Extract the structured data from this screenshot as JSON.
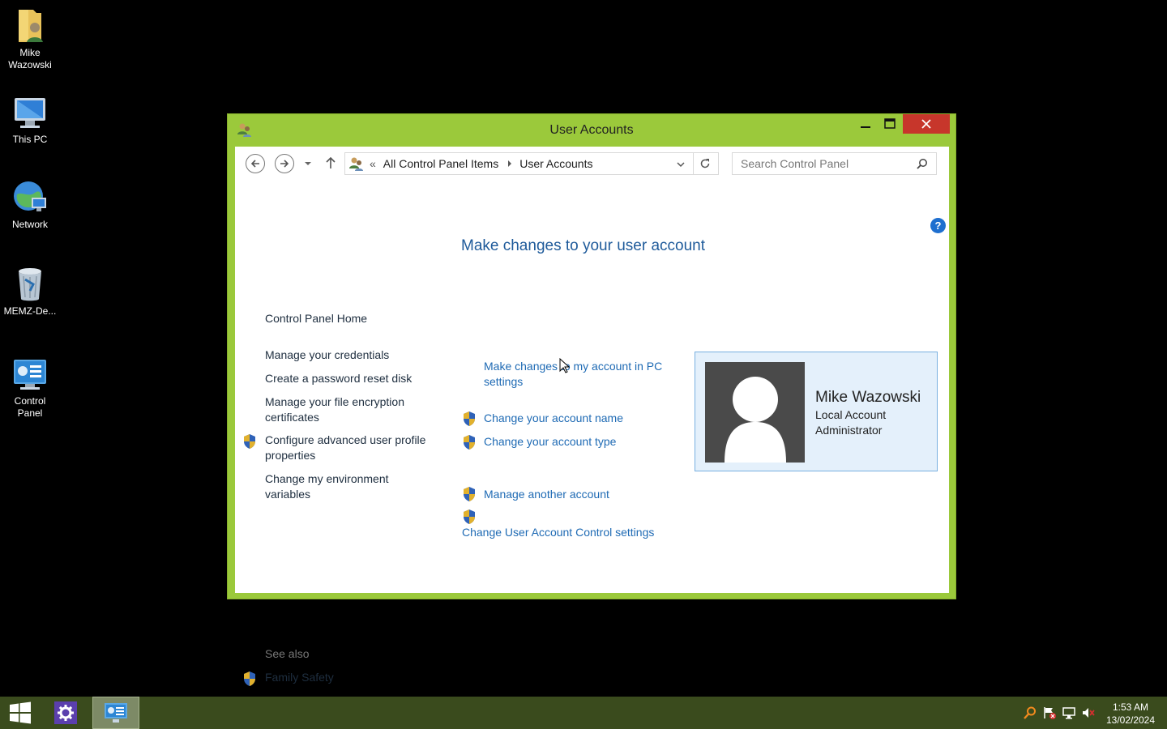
{
  "desktop": {
    "icons": [
      {
        "label": "Mike Wazowski",
        "icon": "user-folder-icon"
      },
      {
        "label": "This PC",
        "icon": "computer-icon"
      },
      {
        "label": "Network",
        "icon": "network-icon"
      },
      {
        "label": "MEMZ-De...",
        "icon": "recycle-bin-icon"
      },
      {
        "label": "Control Panel",
        "icon": "control-panel-icon"
      }
    ]
  },
  "window": {
    "title": "User Accounts",
    "accent_color": "#9bc93b",
    "close_color": "#c7362b",
    "address": {
      "overflow": "«",
      "crumbs": [
        "All Control Panel Items",
        "User Accounts"
      ]
    },
    "search": {
      "placeholder": "Search Control Panel"
    },
    "help_label": "?",
    "left_pane": {
      "home": "Control Panel Home",
      "links": [
        "Manage your credentials",
        "Create a password reset disk",
        "Manage your file encryption certificates",
        "Configure advanced user profile properties",
        "Change my environment variables"
      ],
      "see_also_label": "See also",
      "see_also": [
        "Family Safety"
      ]
    },
    "main": {
      "heading": "Make changes to your user account",
      "tasks": [
        "Make changes to my account in PC settings",
        "Change your account name",
        "Change your account type",
        "Manage another account",
        "Change User Account Control settings"
      ]
    },
    "account": {
      "name": "Mike Wazowski",
      "type": "Local Account",
      "role": "Administrator"
    }
  },
  "taskbar": {
    "color": "#3a4b1d",
    "time": "1:53 AM",
    "date": "13/02/2024"
  }
}
